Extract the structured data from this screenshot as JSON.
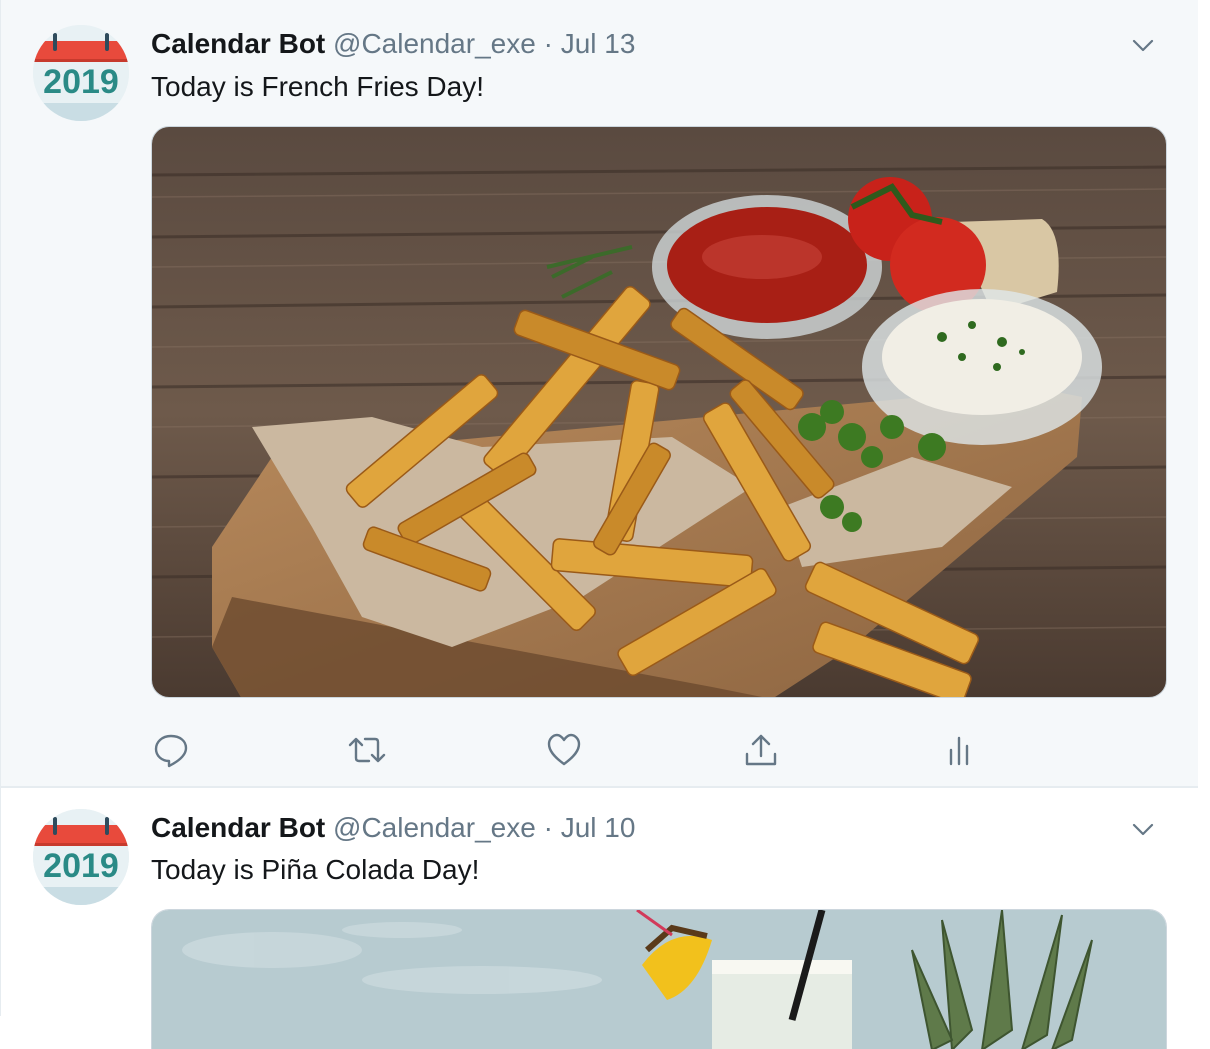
{
  "tweets": [
    {
      "display_name": "Calendar Bot",
      "handle": "@Calendar_exe",
      "separator": "·",
      "date": "Jul 13",
      "text": "Today is French Fries Day!",
      "avatar_year": "2019",
      "media_subject": "french-fries-photo"
    },
    {
      "display_name": "Calendar Bot",
      "handle": "@Calendar_exe",
      "separator": "·",
      "date": "Jul 10",
      "text": "Today is Piña Colada Day!",
      "avatar_year": "2019",
      "media_subject": "pina-colada-photo"
    }
  ],
  "actions": [
    {
      "icon": "reply-icon"
    },
    {
      "icon": "retweet-icon"
    },
    {
      "icon": "like-icon"
    },
    {
      "icon": "share-icon"
    },
    {
      "icon": "analytics-icon"
    }
  ],
  "colors": {
    "background_selected": "#f5f8fa",
    "name": "#14171a",
    "muted": "#657786",
    "avatar_year": "#2a8a86",
    "avatar_red": "#e84a3c",
    "border": "#e6ecf0"
  }
}
